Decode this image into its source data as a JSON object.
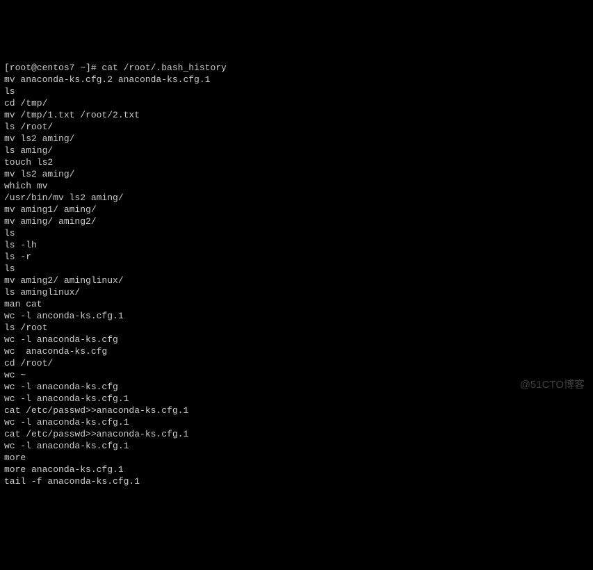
{
  "terminal": {
    "prompt": "[root@centos7 ~]# cat /root/.bash_history",
    "lines": [
      "mv anaconda-ks.cfg.2 anaconda-ks.cfg.1",
      "ls",
      "cd /tmp/",
      "mv /tmp/1.txt /root/2.txt",
      "ls /root/",
      "mv ls2 aming/",
      "ls aming/",
      "touch ls2",
      "mv ls2 aming/",
      "which mv",
      "/usr/bin/mv ls2 aming/",
      "mv aming1/ aming/",
      "mv aming/ aming2/",
      "ls",
      "ls -lh",
      "ls -r",
      "ls",
      "mv aming2/ aminglinux/",
      "ls aminglinux/",
      "man cat",
      "wc -l anconda-ks.cfg.1",
      "ls /root",
      "wc -l anaconda-ks.cfg",
      "wc  anaconda-ks.cfg",
      "cd /root/",
      "wc ~",
      "wc -l anaconda-ks.cfg",
      "wc -l anaconda-ks.cfg.1",
      "cat /etc/passwd>>anaconda-ks.cfg.1",
      "wc -l anaconda-ks.cfg.1",
      "cat /etc/passwd>>anaconda-ks.cfg.1",
      "wc -l anaconda-ks.cfg.1",
      "more",
      "more anaconda-ks.cfg.1",
      "tail -f anaconda-ks.cfg.1"
    ]
  },
  "watermark": "@51CTO博客"
}
